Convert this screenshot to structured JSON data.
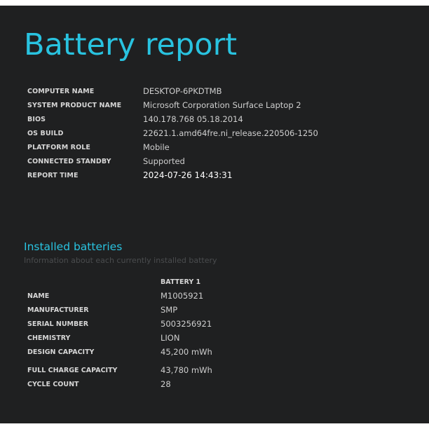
{
  "page": {
    "title": "Battery report"
  },
  "system_info": [
    {
      "label": "COMPUTER NAME",
      "value": "DESKTOP-6PKDTMB"
    },
    {
      "label": "SYSTEM PRODUCT NAME",
      "value": "Microsoft Corporation Surface Laptop 2"
    },
    {
      "label": "BIOS",
      "value": "140.178.768 05.18.2014"
    },
    {
      "label": "OS BUILD",
      "value": "22621.1.amd64fre.ni_release.220506-1250"
    },
    {
      "label": "PLATFORM ROLE",
      "value": "Mobile"
    },
    {
      "label": "CONNECTED STANDBY",
      "value": "Supported"
    },
    {
      "label": "REPORT TIME",
      "value": "2024-07-26  14:43:31"
    }
  ],
  "installed_batteries": {
    "title": "Installed batteries",
    "subtitle": "Information about each currently installed battery",
    "column_header": "BATTERY 1",
    "rows": [
      {
        "label": "NAME",
        "value": "M1005921"
      },
      {
        "label": "MANUFACTURER",
        "value": "SMP"
      },
      {
        "label": "SERIAL NUMBER",
        "value": "5003256921"
      },
      {
        "label": "CHEMISTRY",
        "value": "LION"
      },
      {
        "label": "DESIGN CAPACITY",
        "value": "45,200 mWh"
      },
      {
        "label": "FULL CHARGE CAPACITY",
        "value": "43,780 mWh"
      },
      {
        "label": "CYCLE COUNT",
        "value": "28"
      }
    ]
  },
  "colors": {
    "background": "#1f2021",
    "accent": "#29c3e0",
    "text": "#d8d8d8",
    "muted": "#4a4c4e"
  }
}
